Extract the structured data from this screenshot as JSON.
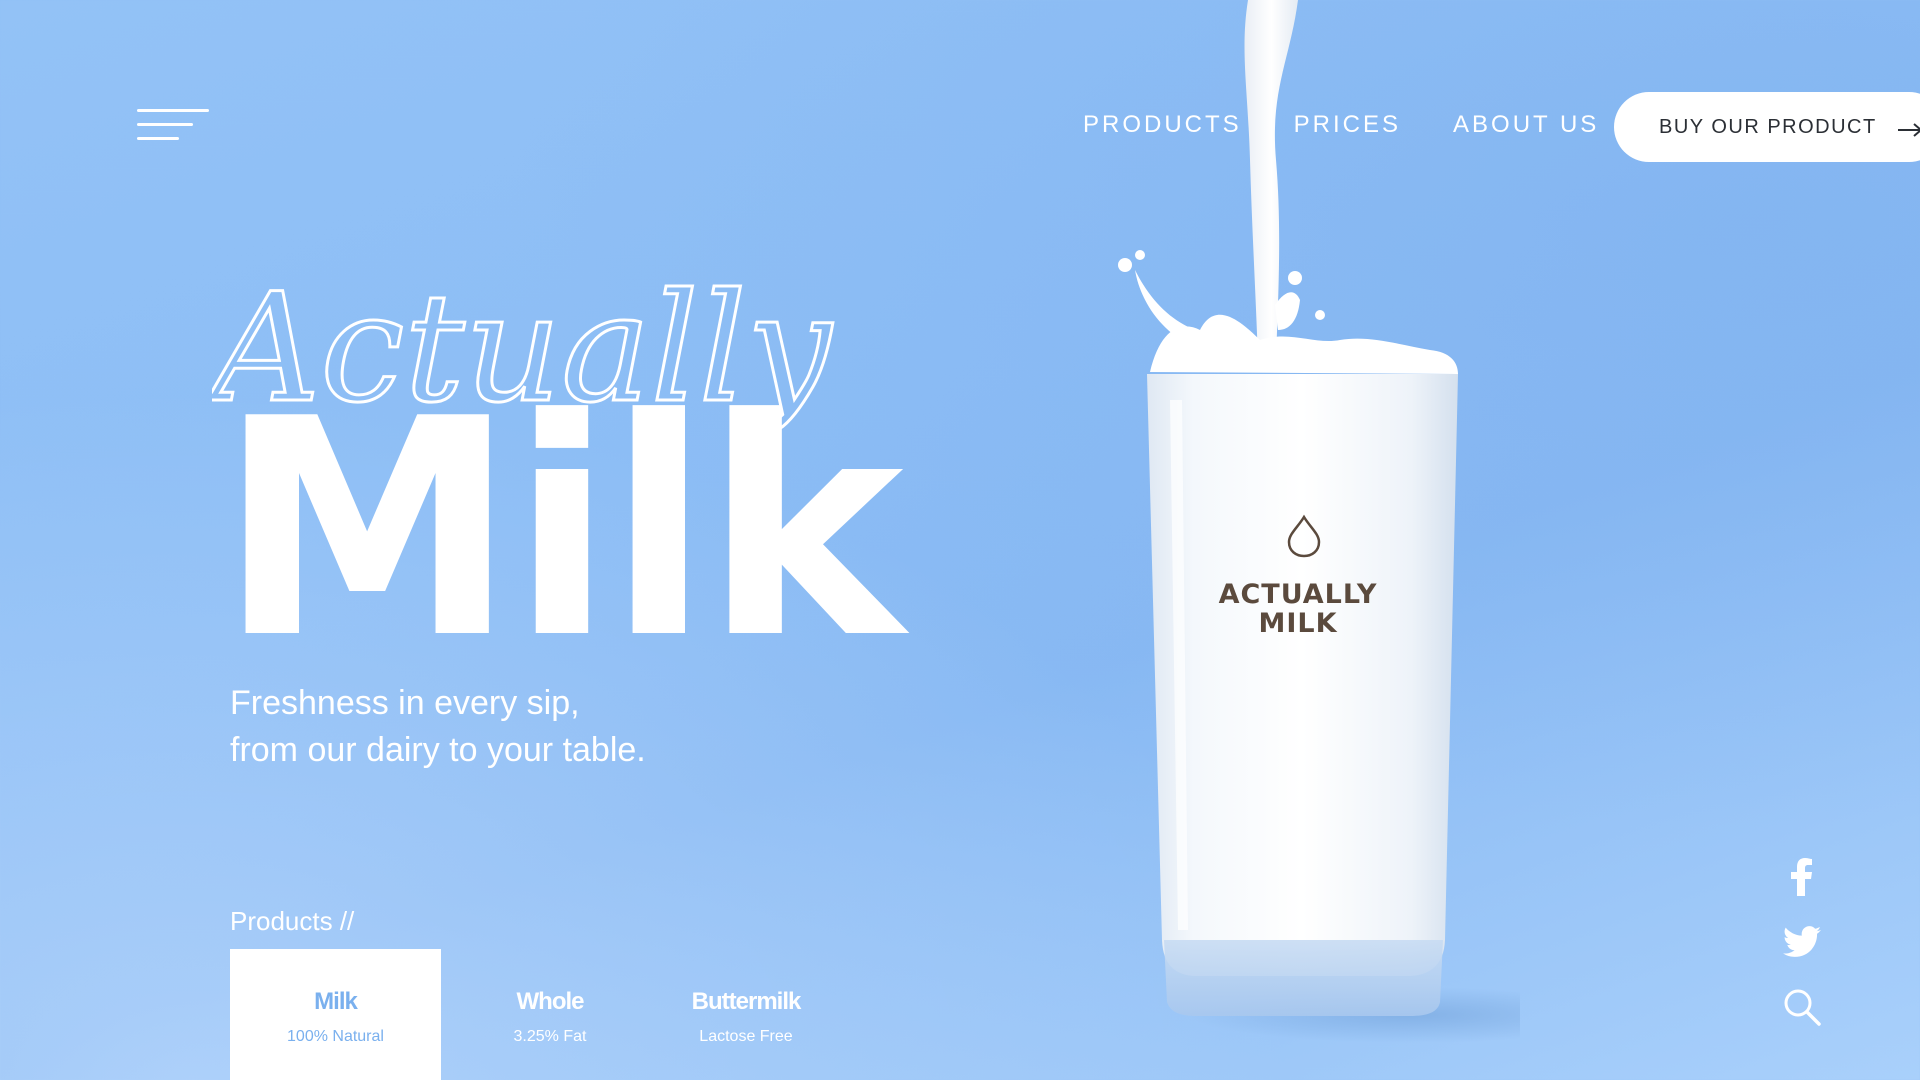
{
  "header": {
    "nav": [
      "PRODUCTS",
      "PRICES",
      "ABOUT US"
    ],
    "cta_label": "BUY OUR PRODUCT"
  },
  "hero": {
    "script_word": "Actually",
    "title": "Milk",
    "tagline_line1": "Freshness in every sip,",
    "tagline_line2": "from our dairy to your table."
  },
  "products": {
    "label": "Products //",
    "items": [
      {
        "name": "Milk",
        "sub": "100% Natural",
        "active": true
      },
      {
        "name": "Whole",
        "sub": "3.25% Fat",
        "active": false
      },
      {
        "name": "Buttermilk",
        "sub": "Lactose Free",
        "active": false
      }
    ]
  },
  "glass": {
    "brand_line1": "ACTUALLY",
    "brand_line2": "MILK"
  },
  "icons": {
    "menu": "hamburger-menu-icon",
    "cta_arrow": "arrow-right-icon",
    "social": [
      "facebook-icon",
      "twitter-icon",
      "search-icon"
    ]
  },
  "colors": {
    "background": "#8cbdf5",
    "accent": "#7ab0ee",
    "button_text": "#2b2f35",
    "brand_text": "#5b4a3d"
  }
}
